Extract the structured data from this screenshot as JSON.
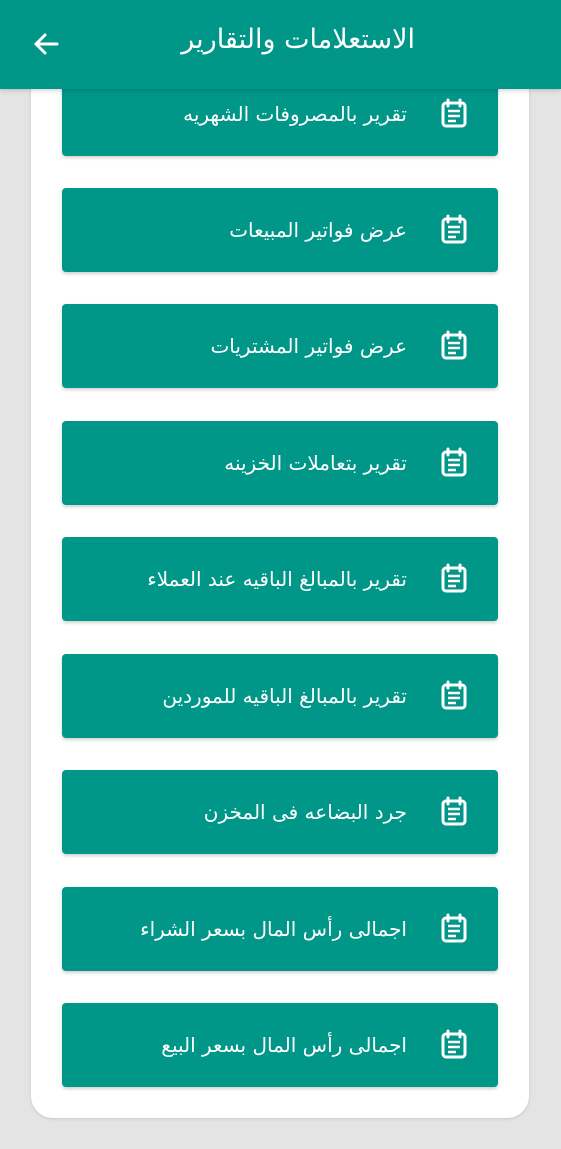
{
  "colors": {
    "primary": "#009688",
    "background": "#e4e4e4",
    "card": "#ffffff",
    "text_on_primary": "#ffffff"
  },
  "app_bar": {
    "title": "الاستعلامات والتقارير",
    "back_icon": "arrow-back-icon"
  },
  "reports": {
    "icon": "report-document-icon",
    "items": [
      {
        "label": "تقرير بالمصروفات الشهريه"
      },
      {
        "label": "عرض فواتير المبيعات"
      },
      {
        "label": "عرض فواتير المشتريات"
      },
      {
        "label": "تقرير بتعاملات الخزينه"
      },
      {
        "label": "تقرير بالمبالغ الباقيه عند العملاء"
      },
      {
        "label": "تقرير بالمبالغ الباقيه للموردين"
      },
      {
        "label": "جرد البضاعه فى المخزن"
      },
      {
        "label": "اجمالى رأس المال بسعر الشراء"
      },
      {
        "label": "اجمالى رأس المال بسعر البيع"
      }
    ]
  }
}
